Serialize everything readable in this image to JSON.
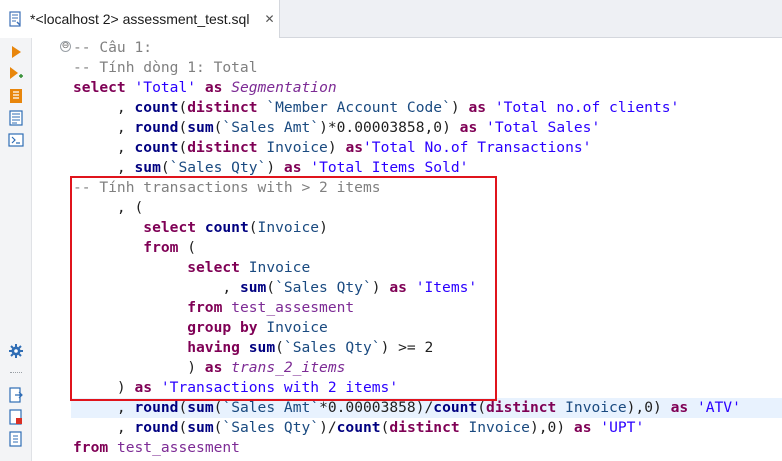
{
  "tab": {
    "title": "*<localhost 2> assessment_test.sql",
    "close_glyph": "✕"
  },
  "toolbar": {
    "tools": [
      "execute-statement-icon",
      "execute-script-icon",
      "explain-plan-icon",
      "sql-template-icon",
      "terminal-icon",
      "settings-icon",
      "export-icon",
      "save-script-icon",
      "open-file-icon"
    ]
  },
  "colors": {
    "keyword": "#7f0055",
    "string": "#2a00ff",
    "comment": "#808080",
    "highlight_box": "#e0141c",
    "current_line": "#e8f2fe"
  },
  "editor": {
    "fold_marker": "⊖",
    "lines": [
      [
        {
          "t": "cm",
          "v": "-- Câu 1:"
        }
      ],
      [
        {
          "t": "cm",
          "v": "-- Tính dòng 1: Total"
        }
      ],
      [
        {
          "t": "kw",
          "v": "select"
        },
        {
          "t": "op",
          "v": " "
        },
        {
          "t": "str",
          "v": "'Total'"
        },
        {
          "t": "op",
          "v": " "
        },
        {
          "t": "kw",
          "v": "as"
        },
        {
          "t": "op",
          "v": " "
        },
        {
          "t": "al",
          "v": "Segmentation"
        }
      ],
      [
        {
          "t": "op",
          "v": "     , "
        },
        {
          "t": "fn",
          "v": "count"
        },
        {
          "t": "op",
          "v": "("
        },
        {
          "t": "kw",
          "v": "distinct"
        },
        {
          "t": "op",
          "v": " "
        },
        {
          "t": "id",
          "v": "`Member Account Code`"
        },
        {
          "t": "op",
          "v": ") "
        },
        {
          "t": "kw",
          "v": "as"
        },
        {
          "t": "op",
          "v": " "
        },
        {
          "t": "str",
          "v": "'Total no.of clients'"
        }
      ],
      [
        {
          "t": "op",
          "v": "     , "
        },
        {
          "t": "fn",
          "v": "round"
        },
        {
          "t": "op",
          "v": "("
        },
        {
          "t": "fn",
          "v": "sum"
        },
        {
          "t": "op",
          "v": "("
        },
        {
          "t": "id",
          "v": "`Sales Amt`"
        },
        {
          "t": "op",
          "v": ")*0.00003858,0) "
        },
        {
          "t": "kw",
          "v": "as"
        },
        {
          "t": "op",
          "v": " "
        },
        {
          "t": "str",
          "v": "'Total Sales'"
        }
      ],
      [
        {
          "t": "op",
          "v": "     , "
        },
        {
          "t": "fn",
          "v": "count"
        },
        {
          "t": "op",
          "v": "("
        },
        {
          "t": "kw",
          "v": "distinct"
        },
        {
          "t": "op",
          "v": " "
        },
        {
          "t": "id",
          "v": "Invoice"
        },
        {
          "t": "op",
          "v": ") "
        },
        {
          "t": "kw",
          "v": "as"
        },
        {
          "t": "str",
          "v": "'Total No.of Transactions'"
        }
      ],
      [
        {
          "t": "op",
          "v": "     , "
        },
        {
          "t": "fn",
          "v": "sum"
        },
        {
          "t": "op",
          "v": "("
        },
        {
          "t": "id",
          "v": "`Sales Qty`"
        },
        {
          "t": "op",
          "v": ") "
        },
        {
          "t": "kw",
          "v": "as"
        },
        {
          "t": "op",
          "v": " "
        },
        {
          "t": "str",
          "v": "'Total Items Sold'"
        }
      ],
      [
        {
          "t": "cm",
          "v": "-- Tính transactions with > 2 items"
        }
      ],
      [
        {
          "t": "op",
          "v": "     , ("
        }
      ],
      [
        {
          "t": "op",
          "v": "        "
        },
        {
          "t": "kw",
          "v": "select"
        },
        {
          "t": "op",
          "v": " "
        },
        {
          "t": "fn",
          "v": "count"
        },
        {
          "t": "op",
          "v": "("
        },
        {
          "t": "id",
          "v": "Invoice"
        },
        {
          "t": "op",
          "v": ")"
        }
      ],
      [
        {
          "t": "op",
          "v": "        "
        },
        {
          "t": "kw",
          "v": "from"
        },
        {
          "t": "op",
          "v": " ("
        }
      ],
      [
        {
          "t": "op",
          "v": "             "
        },
        {
          "t": "kw",
          "v": "select"
        },
        {
          "t": "op",
          "v": " "
        },
        {
          "t": "id",
          "v": "Invoice"
        }
      ],
      [
        {
          "t": "op",
          "v": "                 , "
        },
        {
          "t": "fn",
          "v": "sum"
        },
        {
          "t": "op",
          "v": "("
        },
        {
          "t": "id",
          "v": "`Sales Qty`"
        },
        {
          "t": "op",
          "v": ") "
        },
        {
          "t": "kw",
          "v": "as"
        },
        {
          "t": "op",
          "v": " "
        },
        {
          "t": "str",
          "v": "'Items'"
        }
      ],
      [
        {
          "t": "op",
          "v": "             "
        },
        {
          "t": "kw",
          "v": "from"
        },
        {
          "t": "op",
          "v": " "
        },
        {
          "t": "tb",
          "v": "test_assesment"
        }
      ],
      [
        {
          "t": "op",
          "v": "             "
        },
        {
          "t": "kw",
          "v": "group by"
        },
        {
          "t": "op",
          "v": " "
        },
        {
          "t": "id",
          "v": "Invoice"
        }
      ],
      [
        {
          "t": "op",
          "v": "             "
        },
        {
          "t": "kw",
          "v": "having"
        },
        {
          "t": "op",
          "v": " "
        },
        {
          "t": "fn",
          "v": "sum"
        },
        {
          "t": "op",
          "v": "("
        },
        {
          "t": "id",
          "v": "`Sales Qty`"
        },
        {
          "t": "op",
          "v": ") >= 2"
        }
      ],
      [
        {
          "t": "op",
          "v": "             ) "
        },
        {
          "t": "kw",
          "v": "as"
        },
        {
          "t": "op",
          "v": " "
        },
        {
          "t": "al",
          "v": "trans_2_items"
        }
      ],
      [
        {
          "t": "op",
          "v": "     ) "
        },
        {
          "t": "kw",
          "v": "as"
        },
        {
          "t": "op",
          "v": " "
        },
        {
          "t": "str",
          "v": "'Transactions with 2 items'"
        }
      ],
      [
        {
          "t": "op",
          "v": "     , "
        },
        {
          "t": "fn",
          "v": "round"
        },
        {
          "t": "op",
          "v": "("
        },
        {
          "t": "fn",
          "v": "sum"
        },
        {
          "t": "op",
          "v": "("
        },
        {
          "t": "id",
          "v": "`Sales Amt`"
        },
        {
          "t": "op",
          "v": "*0.00003858)/"
        },
        {
          "t": "fn",
          "v": "count"
        },
        {
          "t": "op",
          "v": "("
        },
        {
          "t": "kw",
          "v": "distinct"
        },
        {
          "t": "op",
          "v": " "
        },
        {
          "t": "id",
          "v": "Invoice"
        },
        {
          "t": "op",
          "v": "),0) "
        },
        {
          "t": "kw",
          "v": "as"
        },
        {
          "t": "op",
          "v": " "
        },
        {
          "t": "str",
          "v": "'ATV'"
        }
      ],
      [
        {
          "t": "op",
          "v": "     , "
        },
        {
          "t": "fn",
          "v": "round"
        },
        {
          "t": "op",
          "v": "("
        },
        {
          "t": "fn",
          "v": "sum"
        },
        {
          "t": "op",
          "v": "("
        },
        {
          "t": "id",
          "v": "`Sales Qty`"
        },
        {
          "t": "op",
          "v": ")/"
        },
        {
          "t": "fn",
          "v": "count"
        },
        {
          "t": "op",
          "v": "("
        },
        {
          "t": "kw",
          "v": "distinct"
        },
        {
          "t": "op",
          "v": " "
        },
        {
          "t": "id",
          "v": "Invoice"
        },
        {
          "t": "op",
          "v": "),0) "
        },
        {
          "t": "kw",
          "v": "as"
        },
        {
          "t": "op",
          "v": " "
        },
        {
          "t": "str",
          "v": "'UPT'"
        }
      ],
      [
        {
          "t": "kw",
          "v": "from"
        },
        {
          "t": "op",
          "v": " "
        },
        {
          "t": "tb",
          "v": "test_assesment"
        }
      ]
    ]
  }
}
